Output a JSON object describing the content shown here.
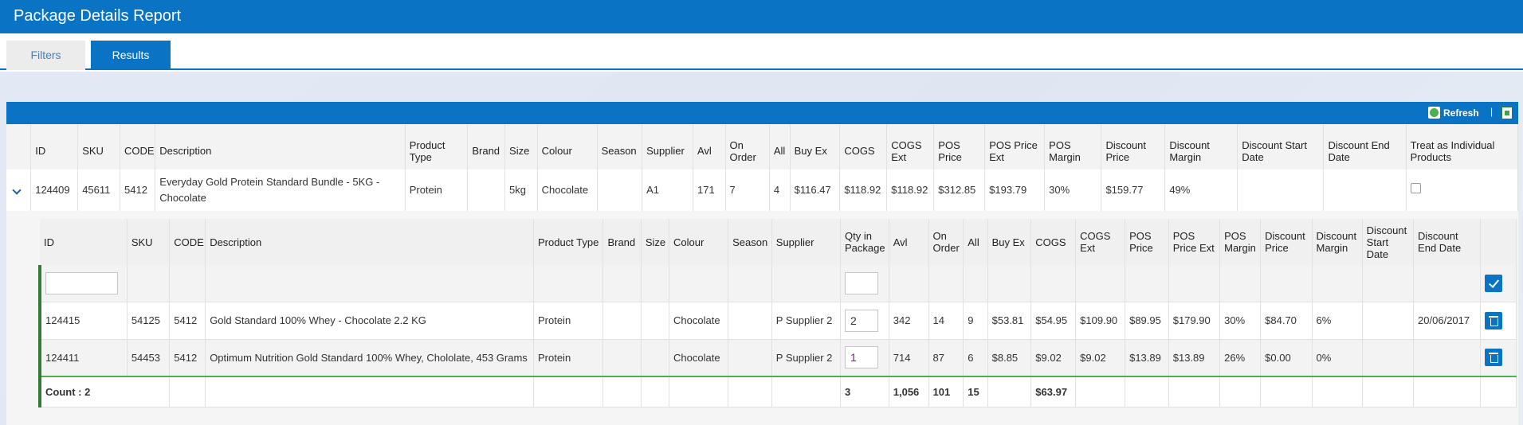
{
  "app": {
    "title": "Package Details Report"
  },
  "tabs": [
    {
      "label": "Filters"
    },
    {
      "label": "Results"
    }
  ],
  "toolbar": {
    "refresh_label": "Refresh",
    "separator": "|"
  },
  "outer": {
    "headers": [
      "ID",
      "SKU",
      "CODE",
      "Description",
      "Product Type",
      "Brand",
      "Size",
      "Colour",
      "Season",
      "Supplier",
      "Avl",
      "On Order",
      "All",
      "Buy Ex",
      "COGS",
      "COGS Ext",
      "POS Price",
      "POS Price Ext",
      "POS Margin",
      "Discount Price",
      "Discount Margin",
      "Discount Start Date",
      "Discount End Date",
      "Treat as Individual Products"
    ],
    "row": {
      "id": "124409",
      "sku": "45611",
      "code": "5412",
      "description": "Everyday Gold Protein Standard Bundle - 5KG - Chocolate",
      "product_type": "Protein",
      "brand": "",
      "size": "5kg",
      "colour": "Chocolate",
      "season": "",
      "supplier": "A1",
      "avl": "171",
      "on_order": "7",
      "all": "4",
      "buy_ex": "$116.47",
      "cogs": "$118.92",
      "cogs_ext": "$118.92",
      "pos_price": "$312.85",
      "pos_price_ext": "$193.79",
      "pos_margin": "30%",
      "discount_price": "$159.77",
      "discount_margin": "49%",
      "discount_start": "",
      "discount_end": ""
    }
  },
  "inner": {
    "headers": [
      "ID",
      "SKU",
      "CODE",
      "Description",
      "Product Type",
      "Brand",
      "Size",
      "Colour",
      "Season",
      "Supplier",
      "Qty in Package",
      "Avl",
      "On Order",
      "All",
      "Buy Ex",
      "COGS",
      "COGS Ext",
      "POS Price",
      "POS Price Ext",
      "POS Margin",
      "Discount Price",
      "Discount Margin",
      "Discount Start Date",
      "Discount End Date"
    ],
    "filter": {
      "id": "",
      "qty": ""
    },
    "rows": [
      {
        "id": "124415",
        "sku": "54125",
        "code": "5412",
        "description": "Gold Standard 100% Whey - Chocolate 2.2 KG",
        "product_type": "Protein",
        "brand": "",
        "size": "",
        "colour": "Chocolate",
        "season": "",
        "supplier": "P Supplier 2",
        "qty": "2",
        "avl": "342",
        "on_order": "14",
        "all": "9",
        "buy_ex": "$53.81",
        "cogs": "$54.95",
        "cogs_ext": "$109.90",
        "pos_price": "$89.95",
        "pos_price_ext": "$179.90",
        "pos_margin": "30%",
        "discount_price": "$84.70",
        "discount_margin": "6%",
        "discount_start": "",
        "discount_end": "20/06/2017"
      },
      {
        "id": "124411",
        "sku": "54453",
        "code": "5412",
        "description": "Optimum Nutrition Gold Standard 100% Whey, Chololate, 453 Grams",
        "product_type": "Protein",
        "brand": "",
        "size": "",
        "colour": "Chocolate",
        "season": "",
        "supplier": "P Supplier 2",
        "qty": "1",
        "avl": "714",
        "on_order": "87",
        "all": "6",
        "buy_ex": "$8.85",
        "cogs": "$9.02",
        "cogs_ext": "$9.02",
        "pos_price": "$13.89",
        "pos_price_ext": "$13.89",
        "pos_margin": "26%",
        "discount_price": "$0.00",
        "discount_margin": "0%",
        "discount_start": "",
        "discount_end": ""
      }
    ],
    "totals": {
      "count_label": "Count : 2",
      "qty": "3",
      "avl": "1,056",
      "on_order": "101",
      "all": "15",
      "cogs": "$63.97"
    }
  },
  "colors": {
    "primary": "#0a73c4",
    "accent_green": "#2e7d32"
  },
  "icons": {
    "expand": "chevron-down-icon",
    "refresh": "refresh-icon",
    "export": "excel-export-icon",
    "save": "checkmark-icon",
    "delete": "trash-icon"
  }
}
